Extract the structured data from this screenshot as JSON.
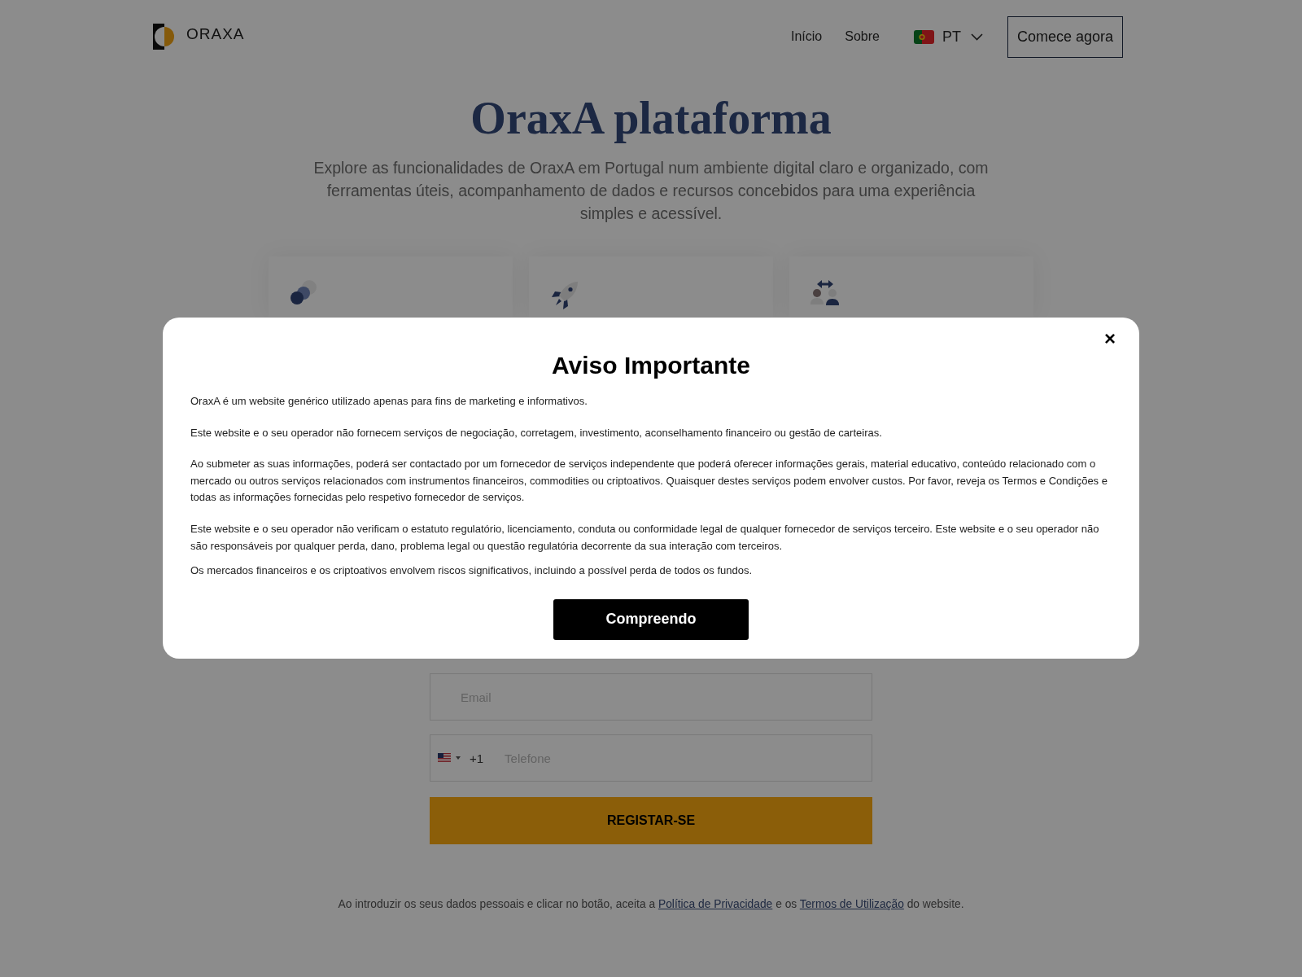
{
  "header": {
    "logo_text": "ORAXA",
    "nav": [
      {
        "label": "Início"
      },
      {
        "label": "Sobre"
      }
    ],
    "language": {
      "code": "PT"
    },
    "cta": "Comece agora"
  },
  "hero": {
    "title": "OraxA plataforma",
    "subtitle": "Explore as funcionalidades de OraxA em Portugal num ambiente digital claro e organizado, com ferramentas úteis, acompanhamento de dados e recursos concebidos para uma experiência simples e acessível."
  },
  "signup_form": {
    "fields": [
      {
        "kind": "email",
        "placeholder": "Email"
      },
      {
        "kind": "phone",
        "dial_code": "+1",
        "placeholder": "Telefone"
      }
    ],
    "submit": "REGISTAR-SE"
  },
  "consent": [
    {
      "kind": "text",
      "text": "Ao introduzir os seus dados pessoais e clicar no botão, aceita a "
    },
    {
      "kind": "link",
      "text": "Política de Privacidade"
    },
    {
      "kind": "text",
      "text": " e os "
    },
    {
      "kind": "link",
      "text": "Termos de Utilização"
    },
    {
      "kind": "text",
      "text": " do website."
    }
  ],
  "modal": {
    "close": "×",
    "title": "Aviso Importante",
    "paragraphs": [
      "OraxA é um website genérico utilizado apenas para fins de marketing e informativos.",
      "Este website e o seu operador não fornecem serviços de negociação, corretagem, investimento, aconselhamento financeiro ou gestão de carteiras.",
      "Ao submeter as suas informações, poderá ser contactado por um fornecedor de serviços independente que poderá oferecer informações gerais, material educativo, conteúdo relacionado com o mercado ou outros serviços relacionados com instrumentos financeiros, commodities ou criptoativos. Quaisquer destes serviços podem envolver custos. Por favor, reveja os Termos e Condições e todas as informações fornecidas pelo respetivo fornecedor de serviços.",
      "Este website e o seu operador não verificam o estatuto regulatório, licenciamento, conduta ou conformidade legal de qualquer fornecedor de serviços terceiro. Este website e o seu operador não são responsáveis por qualquer perda, dano, problema legal ou questão regulatória decorrente da sua interação com terceiros.",
      "Os mercados financeiros e os criptoativos envolvem riscos significativos, incluindo a possível perda de todos os fundos."
    ],
    "button": "Compreendo"
  }
}
